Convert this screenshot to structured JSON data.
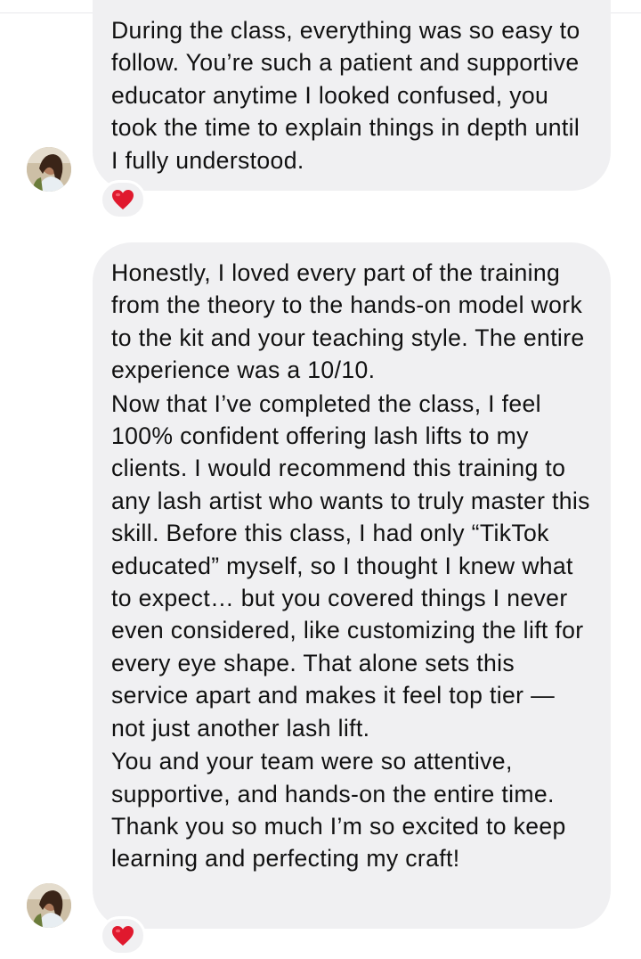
{
  "messages": [
    {
      "paragraphs": [
        "During the class, everything was so easy to follow. You’re such a patient and supportive educator anytime I looked confused, you took the time to explain things in depth until I fully understood."
      ],
      "reaction": "heart-icon"
    },
    {
      "paragraphs": [
        "Honestly, I loved every part of the training from the theory to the hands-on model work to the kit and your teaching style. The entire experience was a 10/10.",
        "Now that I’ve completed the class, I feel 100% confident offering lash lifts to my clients. I would recommend this training to any lash artist who wants to truly master this skill. Before this class, I had only “TikTok educated” myself, so I thought I knew what to expect… but you covered things I never even considered, like customizing the lift for every eye shape. That alone sets this service apart and makes it feel top tier — not just another lash lift.",
        "You and your team were so attentive, supportive, and hands-on the entire time. Thank you so much I’m so excited to keep learning and perfecting my craft!"
      ],
      "reaction": "heart-icon"
    }
  ],
  "colors": {
    "bubble": "#f0f0f2",
    "text": "#111111",
    "heart": "#e0192e"
  }
}
